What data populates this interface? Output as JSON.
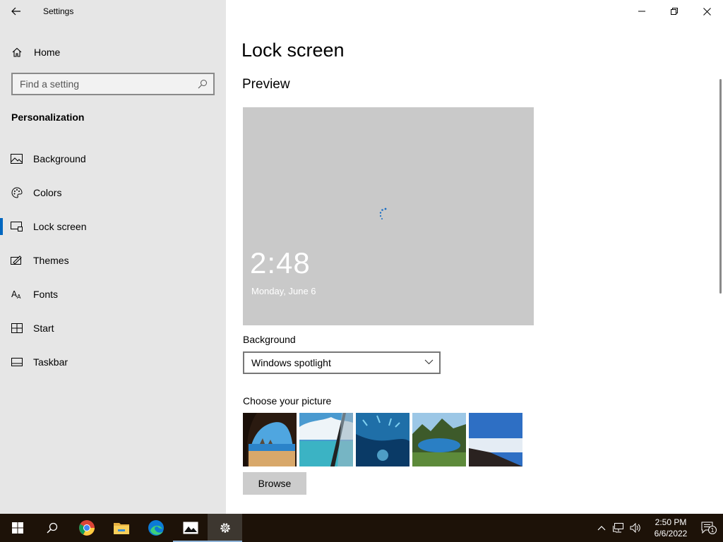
{
  "window": {
    "title": "Settings",
    "controls": [
      "minimize-icon",
      "restore-icon",
      "close-icon"
    ]
  },
  "sidebar": {
    "home_label": "Home",
    "search_placeholder": "Find a setting",
    "section_title": "Personalization",
    "items": [
      {
        "label": "Background",
        "icon": "picture-icon"
      },
      {
        "label": "Colors",
        "icon": "palette-icon"
      },
      {
        "label": "Lock screen",
        "icon": "lock-screen-icon",
        "selected": true
      },
      {
        "label": "Themes",
        "icon": "brush-icon"
      },
      {
        "label": "Fonts",
        "icon": "font-icon"
      },
      {
        "label": "Start",
        "icon": "start-icon"
      },
      {
        "label": "Taskbar",
        "icon": "taskbar-icon"
      }
    ]
  },
  "main": {
    "page_title": "Lock screen",
    "preview_heading": "Preview",
    "preview_time": "2:48",
    "preview_date": "Monday, June 6",
    "background_label": "Background",
    "background_value": "Windows spotlight",
    "choose_label": "Choose your picture",
    "browse_label": "Browse"
  },
  "taskbar": {
    "apps": [
      "windows-start-icon",
      "search-icon",
      "chrome-icon",
      "file-explorer-icon",
      "edge-icon",
      "photos-icon",
      "settings-gear-icon"
    ],
    "clock_time": "2:50 PM",
    "clock_date": "6/6/2022",
    "notification_count": "1"
  },
  "colors": {
    "accent": "#0067c0",
    "sidebar_bg": "#e6e6e6",
    "taskbar_bg": "#1d1208"
  }
}
